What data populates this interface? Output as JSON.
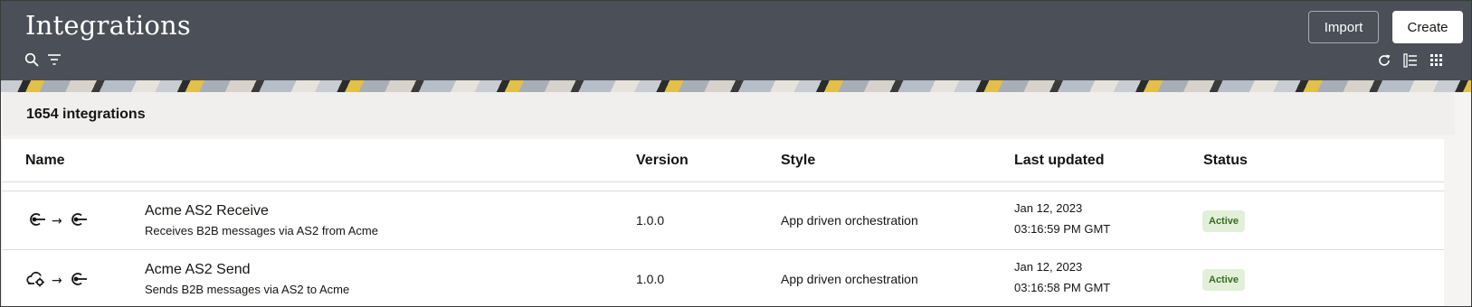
{
  "header": {
    "title": "Integrations",
    "import_label": "Import",
    "create_label": "Create",
    "icons": [
      "search-icon",
      "filter-icon",
      "refresh-icon",
      "list-view-icon",
      "grid-view-icon"
    ]
  },
  "summary": {
    "count_text": "1654 integrations"
  },
  "table": {
    "columns": [
      "Name",
      "Version",
      "Style",
      "Last updated",
      "Status"
    ],
    "rows": [
      {
        "name": "Acme AS2 Receive",
        "description": "Receives B2B messages via AS2 from Acme",
        "version": "1.0.0",
        "style": "App driven orchestration",
        "date": "Jan 12, 2023",
        "time": "03:16:59 PM GMT",
        "status": "Active",
        "icons": [
          "target-icon",
          "target-icon"
        ]
      },
      {
        "name": "Acme AS2 Send",
        "description": "Sends B2B messages via AS2 to Acme",
        "version": "1.0.0",
        "style": "App driven orchestration",
        "date": "Jan 12, 2023",
        "time": "03:16:58 PM GMT",
        "status": "Active",
        "icons": [
          "cloud-gear-icon",
          "target-icon"
        ]
      }
    ]
  },
  "colors": {
    "header_bg": "#4b4f57",
    "active_badge_bg": "#e2f0d9",
    "active_badge_text": "#3a6a22"
  }
}
